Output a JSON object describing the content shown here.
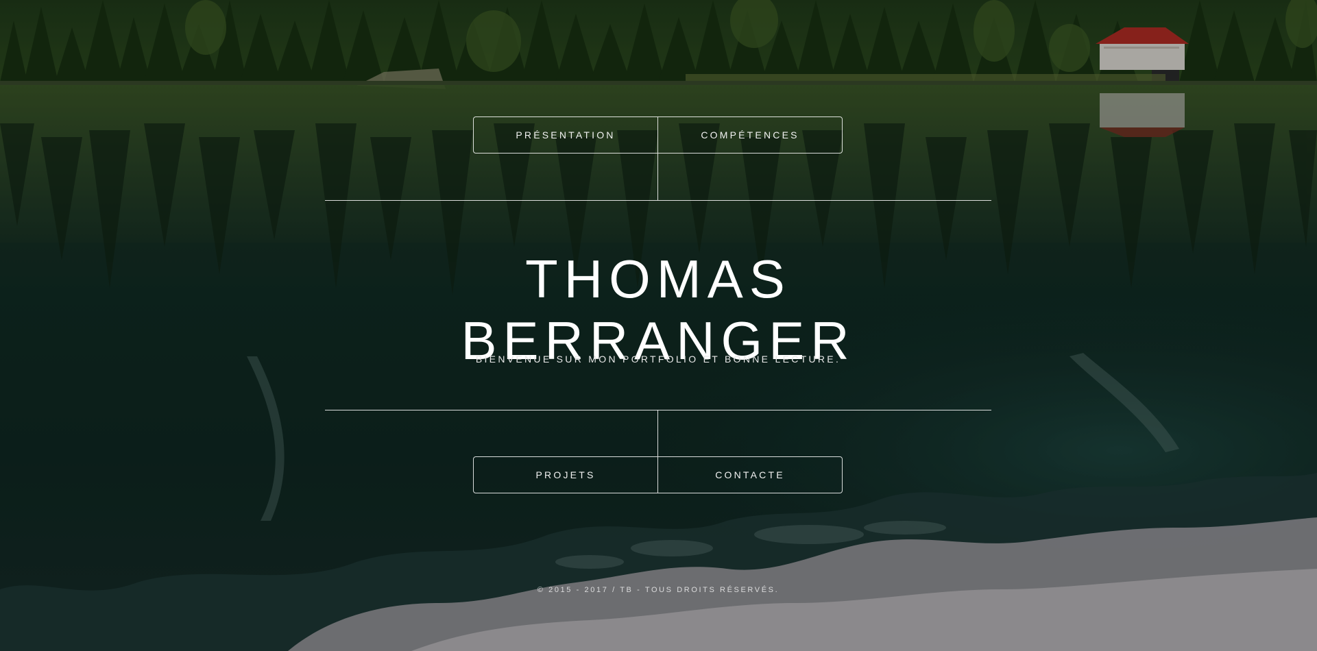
{
  "nav_top": {
    "items": [
      {
        "label": "PRÉSENTATION"
      },
      {
        "label": "COMPÉTENCES"
      }
    ]
  },
  "header": {
    "title": "THOMAS BERRANGER",
    "subtitle": "BIENVENUE SUR MON PORTFOLIO ET BONNE LECTURE."
  },
  "nav_bottom": {
    "items": [
      {
        "label": "PROJETS"
      },
      {
        "label": "CONTACTE"
      }
    ]
  },
  "footer": {
    "text": "© 2015 - 2017 / TB - TOUS DROITS RÉSERVÉS."
  },
  "colors": {
    "text": "#ffffff",
    "border": "#ffffff",
    "forest": "#1f3a1e",
    "water": "#10241e",
    "snow_reflection": "#b8b4b8"
  }
}
